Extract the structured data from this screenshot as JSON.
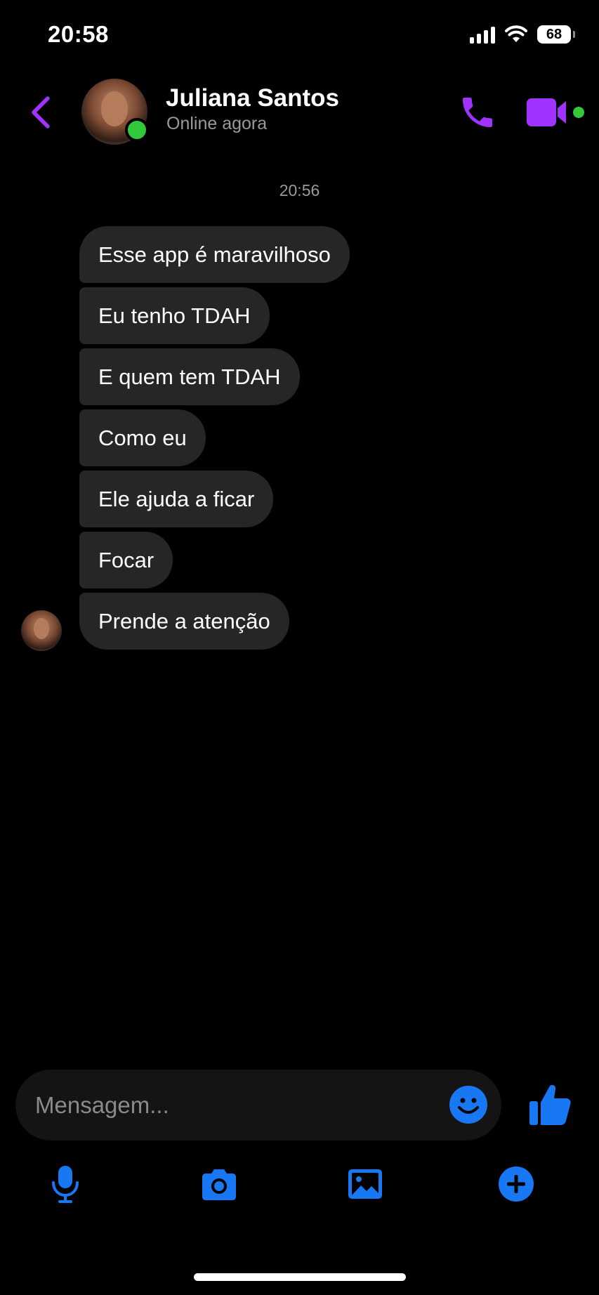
{
  "status_bar": {
    "time": "20:58",
    "battery": "68",
    "icons": [
      "cellular-signal-icon",
      "wifi-icon",
      "battery-icon"
    ]
  },
  "header": {
    "contact_name": "Juliana Santos",
    "contact_status": "Online agora",
    "icons": [
      "chevron-left-icon",
      "phone-icon",
      "video-camera-icon"
    ]
  },
  "conversation": {
    "timestamp": "20:56",
    "messages": [
      "Esse app é maravilhoso",
      "Eu tenho TDAH",
      "E quem tem TDAH",
      "Como eu",
      "Ele ajuda a ficar",
      "Focar",
      "Prende a atenção"
    ]
  },
  "composer": {
    "placeholder": "Mensagem...",
    "value": "",
    "icons": [
      "smiley-icon",
      "thumbs-up-icon"
    ]
  },
  "toolbar": {
    "icons": [
      "microphone-icon",
      "camera-icon",
      "image-gallery-icon",
      "plus-circle-icon"
    ]
  },
  "colors": {
    "background": "#000000",
    "bubble": "#262626",
    "accent_purple": "#a033ff",
    "accent_blue": "#1877f2",
    "online_green": "#31c83a",
    "secondary_text": "#9a9a9a"
  }
}
